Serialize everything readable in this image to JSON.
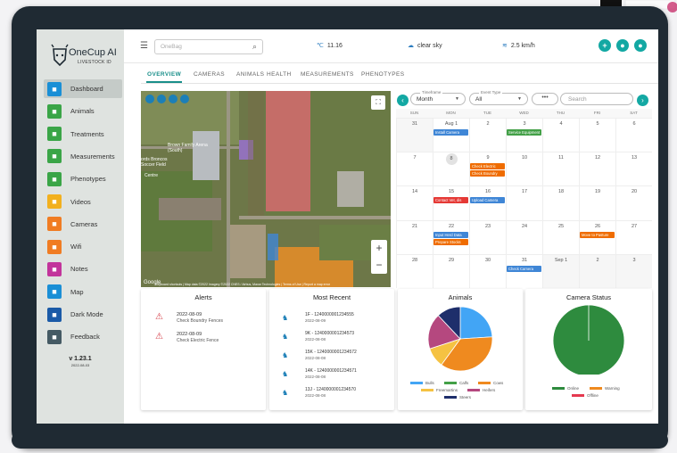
{
  "app": {
    "logo_title": "OneCup AI",
    "logo_subtitle": "LIVESTOCK ID",
    "version": "v 1.23.1",
    "version_date": "2022-08-03"
  },
  "sidebar": {
    "items": [
      {
        "label": "Dashboard",
        "icon": "home-icon",
        "color": "#1a8fd6",
        "active": true
      },
      {
        "label": "Animals",
        "icon": "cow-icon",
        "color": "#3aa547"
      },
      {
        "label": "Treatments",
        "icon": "syringe-icon",
        "color": "#3aa547"
      },
      {
        "label": "Measurements",
        "icon": "ruler-icon",
        "color": "#3aa547"
      },
      {
        "label": "Phenotypes",
        "icon": "dna-icon",
        "color": "#3aa547"
      },
      {
        "label": "Videos",
        "icon": "video-icon",
        "color": "#f2b01e"
      },
      {
        "label": "Cameras",
        "icon": "camera-icon",
        "color": "#f07c23"
      },
      {
        "label": "Wifi",
        "icon": "wifi-icon",
        "color": "#f07c23"
      },
      {
        "label": "Notes",
        "icon": "note-icon",
        "color": "#c2349b"
      },
      {
        "label": "Map",
        "icon": "map-icon",
        "color": "#1a8fd6"
      },
      {
        "label": "Dark Mode",
        "icon": "moon-icon",
        "color": "#1a5aa7"
      },
      {
        "label": "Feedback",
        "icon": "chat-icon",
        "color": "#455a64"
      }
    ]
  },
  "topbar": {
    "search_placeholder": "OneBag",
    "temperature": "11.16",
    "sky": "clear sky",
    "wind": "2.5 km/h"
  },
  "tabs": [
    "OVERVIEW",
    "CAMERAS",
    "ANIMALS",
    "HEALTH",
    "MEASUREMENTS",
    "PHENOTYPES"
  ],
  "map": {
    "label_arena": "Brown Family Arena (South)",
    "label_field": "ords Broncos Soccer Field",
    "label_center": "Centre",
    "attribution": "Keyboard shortcuts  |  Map data ©2022 Imagery ©2022 CNES / Airbus, Maxar Technologies  |  Terms of Use  |  Report a map error",
    "brand": "Google",
    "zoom_in": "+",
    "zoom_out": "−"
  },
  "calendar": {
    "timeframe_label": "Timeframe",
    "timeframe": "Month",
    "event_type_label": "Event Type",
    "event_type": "All",
    "more": "•••",
    "search_placeholder": "Search",
    "days_of_week": [
      "SUN",
      "MON",
      "TUE",
      "WED",
      "THU",
      "FRI",
      "SAT"
    ],
    "weeks": [
      [
        "31",
        "Aug 1",
        "2",
        "3",
        "4",
        "5",
        "6"
      ],
      [
        "7",
        "8",
        "9",
        "10",
        "11",
        "12",
        "13"
      ],
      [
        "14",
        "15",
        "16",
        "17",
        "18",
        "19",
        "20"
      ],
      [
        "21",
        "22",
        "23",
        "24",
        "25",
        "26",
        "27"
      ],
      [
        "28",
        "29",
        "30",
        "31",
        "Sep 1",
        "2",
        "3"
      ]
    ],
    "events": [
      {
        "week": 0,
        "day": 1,
        "row": 0,
        "text": "Install Camera",
        "color": "#3f86d6"
      },
      {
        "week": 0,
        "day": 3,
        "row": 0,
        "text": "Service Equipment",
        "color": "#43a047"
      },
      {
        "week": 1,
        "day": 2,
        "row": 0,
        "text": "Check Electric",
        "color": "#ef6c00"
      },
      {
        "week": 1,
        "day": 2,
        "row": 1,
        "text": "Check Boundry",
        "color": "#ef6c00"
      },
      {
        "week": 2,
        "day": 1,
        "row": 0,
        "text": "Contact Vet, dis",
        "color": "#e53935"
      },
      {
        "week": 2,
        "day": 2,
        "row": 0,
        "text": "Upload Camera",
        "color": "#3f86d6"
      },
      {
        "week": 3,
        "day": 1,
        "row": 0,
        "text": "Input Herd Data",
        "color": "#3f86d6"
      },
      {
        "week": 3,
        "day": 1,
        "row": 1,
        "text": "Prepare Stocks",
        "color": "#ef6c00"
      },
      {
        "week": 3,
        "day": 5,
        "row": 0,
        "text": "Move to Pasture",
        "color": "#ef6c00"
      },
      {
        "week": 4,
        "day": 3,
        "row": 0,
        "text": "Check Camera",
        "color": "#3f86d6"
      }
    ]
  },
  "alerts": {
    "title": "Alerts",
    "items": [
      {
        "date": "2022-08-09",
        "text": "Check Boundry Fences"
      },
      {
        "date": "2022-08-09",
        "text": "Check Electric Fence"
      }
    ]
  },
  "recent": {
    "title": "Most Recent",
    "items": [
      {
        "id": "1F - 1240000001234555",
        "date": "2022-08-09"
      },
      {
        "id": "9K - 1240000001234573",
        "date": "2022-08-08"
      },
      {
        "id": "15K - 1240000001234572",
        "date": "2022-08-08"
      },
      {
        "id": "14K - 1240000001234571",
        "date": "2022-08-08"
      },
      {
        "id": "13J - 1240000001234570",
        "date": "2022-08-08"
      }
    ]
  },
  "animals_chart": {
    "title": "Animals",
    "slices": [
      {
        "name": "Bulls",
        "value": 24,
        "color": "#42a5f5"
      },
      {
        "name": "Calfs",
        "value": 0,
        "color": "#43a047"
      },
      {
        "name": "Cows",
        "value": 36,
        "color": "#ef8a1f"
      },
      {
        "name": "Freemartins",
        "value": 10,
        "color": "#f5c242"
      },
      {
        "name": "Heifers",
        "value": 18,
        "color": "#b5487f"
      },
      {
        "name": "Steers",
        "value": 12,
        "color": "#1e2e6b"
      }
    ]
  },
  "camera_chart": {
    "title": "Camera Status",
    "slices": [
      {
        "name": "Online",
        "value": 100,
        "color": "#2e8b3e"
      },
      {
        "name": "Warning",
        "value": 0,
        "color": "#ef8a1f"
      },
      {
        "name": "Offline",
        "value": 0,
        "color": "#e53950"
      }
    ]
  }
}
